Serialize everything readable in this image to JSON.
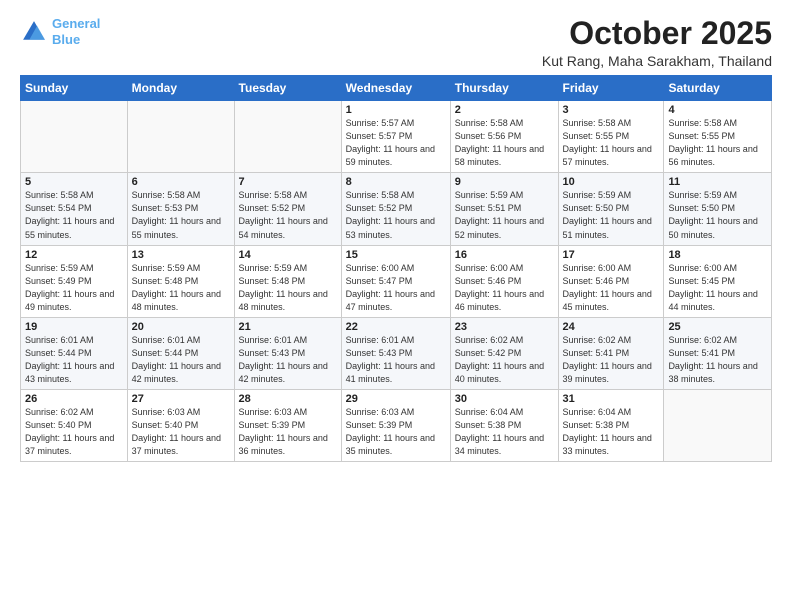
{
  "header": {
    "logo_line1": "General",
    "logo_line2": "Blue",
    "month_title": "October 2025",
    "location": "Kut Rang, Maha Sarakham, Thailand"
  },
  "weekdays": [
    "Sunday",
    "Monday",
    "Tuesday",
    "Wednesday",
    "Thursday",
    "Friday",
    "Saturday"
  ],
  "weeks": [
    [
      {
        "day": "",
        "sunrise": "",
        "sunset": "",
        "daylight": ""
      },
      {
        "day": "",
        "sunrise": "",
        "sunset": "",
        "daylight": ""
      },
      {
        "day": "",
        "sunrise": "",
        "sunset": "",
        "daylight": ""
      },
      {
        "day": "1",
        "sunrise": "Sunrise: 5:57 AM",
        "sunset": "Sunset: 5:57 PM",
        "daylight": "Daylight: 11 hours and 59 minutes."
      },
      {
        "day": "2",
        "sunrise": "Sunrise: 5:58 AM",
        "sunset": "Sunset: 5:56 PM",
        "daylight": "Daylight: 11 hours and 58 minutes."
      },
      {
        "day": "3",
        "sunrise": "Sunrise: 5:58 AM",
        "sunset": "Sunset: 5:55 PM",
        "daylight": "Daylight: 11 hours and 57 minutes."
      },
      {
        "day": "4",
        "sunrise": "Sunrise: 5:58 AM",
        "sunset": "Sunset: 5:55 PM",
        "daylight": "Daylight: 11 hours and 56 minutes."
      }
    ],
    [
      {
        "day": "5",
        "sunrise": "Sunrise: 5:58 AM",
        "sunset": "Sunset: 5:54 PM",
        "daylight": "Daylight: 11 hours and 55 minutes."
      },
      {
        "day": "6",
        "sunrise": "Sunrise: 5:58 AM",
        "sunset": "Sunset: 5:53 PM",
        "daylight": "Daylight: 11 hours and 55 minutes."
      },
      {
        "day": "7",
        "sunrise": "Sunrise: 5:58 AM",
        "sunset": "Sunset: 5:52 PM",
        "daylight": "Daylight: 11 hours and 54 minutes."
      },
      {
        "day": "8",
        "sunrise": "Sunrise: 5:58 AM",
        "sunset": "Sunset: 5:52 PM",
        "daylight": "Daylight: 11 hours and 53 minutes."
      },
      {
        "day": "9",
        "sunrise": "Sunrise: 5:59 AM",
        "sunset": "Sunset: 5:51 PM",
        "daylight": "Daylight: 11 hours and 52 minutes."
      },
      {
        "day": "10",
        "sunrise": "Sunrise: 5:59 AM",
        "sunset": "Sunset: 5:50 PM",
        "daylight": "Daylight: 11 hours and 51 minutes."
      },
      {
        "day": "11",
        "sunrise": "Sunrise: 5:59 AM",
        "sunset": "Sunset: 5:50 PM",
        "daylight": "Daylight: 11 hours and 50 minutes."
      }
    ],
    [
      {
        "day": "12",
        "sunrise": "Sunrise: 5:59 AM",
        "sunset": "Sunset: 5:49 PM",
        "daylight": "Daylight: 11 hours and 49 minutes."
      },
      {
        "day": "13",
        "sunrise": "Sunrise: 5:59 AM",
        "sunset": "Sunset: 5:48 PM",
        "daylight": "Daylight: 11 hours and 48 minutes."
      },
      {
        "day": "14",
        "sunrise": "Sunrise: 5:59 AM",
        "sunset": "Sunset: 5:48 PM",
        "daylight": "Daylight: 11 hours and 48 minutes."
      },
      {
        "day": "15",
        "sunrise": "Sunrise: 6:00 AM",
        "sunset": "Sunset: 5:47 PM",
        "daylight": "Daylight: 11 hours and 47 minutes."
      },
      {
        "day": "16",
        "sunrise": "Sunrise: 6:00 AM",
        "sunset": "Sunset: 5:46 PM",
        "daylight": "Daylight: 11 hours and 46 minutes."
      },
      {
        "day": "17",
        "sunrise": "Sunrise: 6:00 AM",
        "sunset": "Sunset: 5:46 PM",
        "daylight": "Daylight: 11 hours and 45 minutes."
      },
      {
        "day": "18",
        "sunrise": "Sunrise: 6:00 AM",
        "sunset": "Sunset: 5:45 PM",
        "daylight": "Daylight: 11 hours and 44 minutes."
      }
    ],
    [
      {
        "day": "19",
        "sunrise": "Sunrise: 6:01 AM",
        "sunset": "Sunset: 5:44 PM",
        "daylight": "Daylight: 11 hours and 43 minutes."
      },
      {
        "day": "20",
        "sunrise": "Sunrise: 6:01 AM",
        "sunset": "Sunset: 5:44 PM",
        "daylight": "Daylight: 11 hours and 42 minutes."
      },
      {
        "day": "21",
        "sunrise": "Sunrise: 6:01 AM",
        "sunset": "Sunset: 5:43 PM",
        "daylight": "Daylight: 11 hours and 42 minutes."
      },
      {
        "day": "22",
        "sunrise": "Sunrise: 6:01 AM",
        "sunset": "Sunset: 5:43 PM",
        "daylight": "Daylight: 11 hours and 41 minutes."
      },
      {
        "day": "23",
        "sunrise": "Sunrise: 6:02 AM",
        "sunset": "Sunset: 5:42 PM",
        "daylight": "Daylight: 11 hours and 40 minutes."
      },
      {
        "day": "24",
        "sunrise": "Sunrise: 6:02 AM",
        "sunset": "Sunset: 5:41 PM",
        "daylight": "Daylight: 11 hours and 39 minutes."
      },
      {
        "day": "25",
        "sunrise": "Sunrise: 6:02 AM",
        "sunset": "Sunset: 5:41 PM",
        "daylight": "Daylight: 11 hours and 38 minutes."
      }
    ],
    [
      {
        "day": "26",
        "sunrise": "Sunrise: 6:02 AM",
        "sunset": "Sunset: 5:40 PM",
        "daylight": "Daylight: 11 hours and 37 minutes."
      },
      {
        "day": "27",
        "sunrise": "Sunrise: 6:03 AM",
        "sunset": "Sunset: 5:40 PM",
        "daylight": "Daylight: 11 hours and 37 minutes."
      },
      {
        "day": "28",
        "sunrise": "Sunrise: 6:03 AM",
        "sunset": "Sunset: 5:39 PM",
        "daylight": "Daylight: 11 hours and 36 minutes."
      },
      {
        "day": "29",
        "sunrise": "Sunrise: 6:03 AM",
        "sunset": "Sunset: 5:39 PM",
        "daylight": "Daylight: 11 hours and 35 minutes."
      },
      {
        "day": "30",
        "sunrise": "Sunrise: 6:04 AM",
        "sunset": "Sunset: 5:38 PM",
        "daylight": "Daylight: 11 hours and 34 minutes."
      },
      {
        "day": "31",
        "sunrise": "Sunrise: 6:04 AM",
        "sunset": "Sunset: 5:38 PM",
        "daylight": "Daylight: 11 hours and 33 minutes."
      },
      {
        "day": "",
        "sunrise": "",
        "sunset": "",
        "daylight": ""
      }
    ]
  ]
}
